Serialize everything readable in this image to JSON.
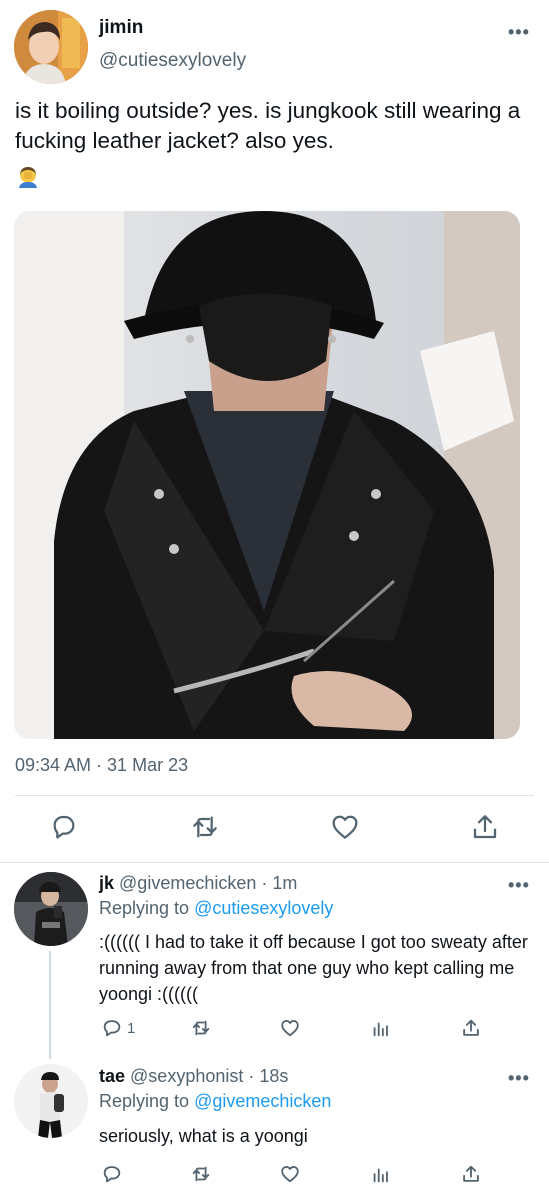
{
  "tweet": {
    "name": "jimin",
    "handle": "@cutiesexylovely",
    "more_icon": "more-dots",
    "text": "is it boiling outside? yes. is jungkook still wearing a fucking leather jacket? also yes.",
    "emoji": "🤦‍♂️",
    "timestamp": "09:34 AM · 31 Mar 23",
    "actions": [
      "reply-icon",
      "retweet-icon",
      "like-icon",
      "share-icon"
    ]
  },
  "replies": [
    {
      "name": "jk",
      "handle": "@givemechicken",
      "time": "· 1m",
      "replying_label": "Replying to",
      "replying_to": "@cutiesexylovely",
      "text": ":(((((( I had to take it off because I got too sweaty after running away from that one guy who kept calling me yoongi :((((((",
      "reply_count": "1"
    },
    {
      "name": "tae",
      "handle": "@sexyphonist",
      "time": "· 18s",
      "replying_label": "Replying to",
      "replying_to": "@givemechicken",
      "text": "seriously, what is a yoongi"
    }
  ],
  "colors": {
    "link": "#1d9bf0",
    "secondary": "#536471",
    "divider": "#dfe3e6"
  }
}
